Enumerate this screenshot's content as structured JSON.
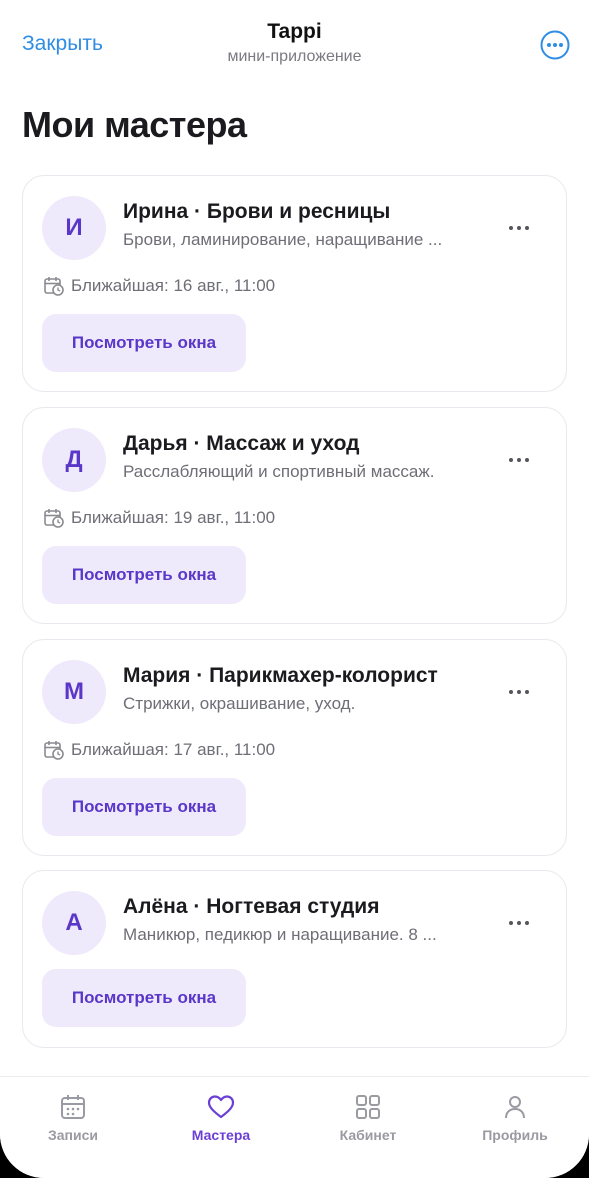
{
  "header": {
    "close_label": "Закрыть",
    "title": "Tappi",
    "subtitle": "мини-приложение"
  },
  "page": {
    "title": "Мои мастера"
  },
  "masters": [
    {
      "initial": "И",
      "name": "Ирина · Брови и ресницы",
      "description": "Брови, ламинирование, наращивание ...",
      "next": "Ближайшая: 16 авг., 11:00",
      "button": "Посмотреть окна"
    },
    {
      "initial": "Д",
      "name": "Дарья · Массаж и уход",
      "description": "Расслабляющий и спортивный массаж.",
      "next": "Ближайшая: 19 авг., 11:00",
      "button": "Посмотреть окна"
    },
    {
      "initial": "М",
      "name": "Мария · Парикмахер-колорист",
      "description": "Стрижки, окрашивание, уход.",
      "next": "Ближайшая: 17 авг., 11:00",
      "button": "Посмотреть окна"
    },
    {
      "initial": "А",
      "name": "Алёна · Ногтевая студия",
      "description": "Маникюр, педикюр и наращивание. 8 ...",
      "button": "Посмотреть окна"
    }
  ],
  "tabbar": {
    "tabs": [
      {
        "label": "Записи",
        "icon": "calendar-icon"
      },
      {
        "label": "Мастера",
        "icon": "heart-icon",
        "active": true
      },
      {
        "label": "Кабинет",
        "icon": "grid-icon"
      },
      {
        "label": "Профиль",
        "icon": "person-icon"
      }
    ]
  },
  "colors": {
    "accent": "#5a37c8",
    "accent_soft": "#efeafb",
    "link": "#2f8de4",
    "tab_active": "#6b3fd6",
    "tab_inactive": "#9a9aa2"
  }
}
